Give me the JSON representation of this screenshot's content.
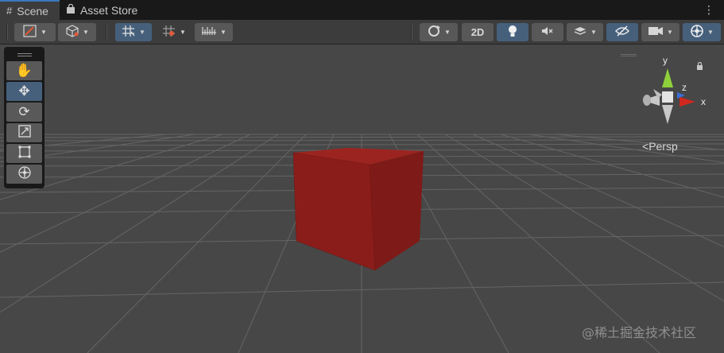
{
  "tabs": [
    {
      "label": "Scene",
      "icon": "hash-grid-icon",
      "active": true
    },
    {
      "label": "Asset Store",
      "icon": "shopping-bag-icon",
      "active": false
    }
  ],
  "toolbar": {
    "draw_mode_icon": "brush-icon",
    "render_mode_icon": "cube-outline-icon",
    "grid_snap_icon": "grid-snap-icon",
    "increment_snap_icon": "increment-snap-icon",
    "ruler_icon": "ruler-icon",
    "orbit_icon": "orbit-icon",
    "mode_2d_label": "2D",
    "lighting_icon": "lightbulb-icon",
    "audio_icon": "audio-mute-icon",
    "effects_icon": "layers-icon",
    "visibility_icon": "eye-slash-icon",
    "camera_icon": "camera-icon",
    "gizmos_icon": "gizmo-globe-icon"
  },
  "tools": [
    {
      "name": "hand-tool",
      "icon": "hand-icon",
      "active": false
    },
    {
      "name": "move-tool",
      "icon": "move-arrows-icon",
      "active": true
    },
    {
      "name": "rotate-tool",
      "icon": "rotate-icon",
      "active": false
    },
    {
      "name": "scale-tool",
      "icon": "scale-icon",
      "active": false
    },
    {
      "name": "rect-tool",
      "icon": "rect-transform-icon",
      "active": false
    },
    {
      "name": "transform-tool",
      "icon": "transform-icon",
      "active": false
    }
  ],
  "gizmo": {
    "axis_y": "y",
    "axis_z": "z",
    "axis_x": "x",
    "projection_label": "Persp",
    "colors": {
      "x": "#d0281f",
      "y": "#8fd13a",
      "z": "#3a6fd8"
    }
  },
  "scene": {
    "cube_color": "#8f1c1c",
    "background": "#474747",
    "grid_color": "#6a6a6a"
  },
  "watermark": "@稀土掘金技术社区"
}
